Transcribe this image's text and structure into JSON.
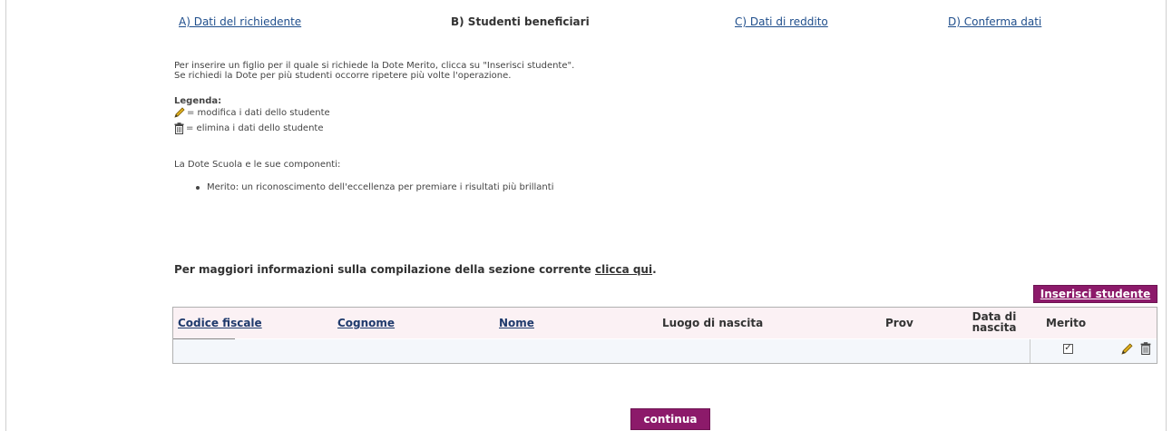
{
  "steps": {
    "a": "A) Dati del richiedente",
    "b": "B) Studenti beneficiari",
    "c": "C) Dati di reddito",
    "d": "D) Conferma dati"
  },
  "intro": {
    "line1": "Per inserire un figlio per il quale si richiede la Dote Merito, clicca su \"Inserisci studente\".",
    "line2": "Se richiedi la Dote per più studenti occorre ripetere più volte l'operazione."
  },
  "legend": {
    "title": "Legenda:",
    "edit": "= modifica i dati dello studente",
    "delete": "= elimina i dati dello studente",
    "edit_icon": "pencil-icon",
    "delete_icon": "trash-icon"
  },
  "components": {
    "label": "La Dote Scuola e le sue componenti:",
    "item1": "Merito: un riconoscimento dell'eccellenza per premiare i risultati più brillanti"
  },
  "moreinfo": {
    "text": "Per maggiori informazioni sulla compilazione della sezione corrente ",
    "link": "clicca qui",
    "suffix": "."
  },
  "buttons": {
    "insert": "Inserisci studente",
    "continue": "continua"
  },
  "table": {
    "headers": {
      "codice": "Codice fiscale",
      "cognome": "Cognome",
      "nome": "Nome",
      "luogo": "Luogo di nascita",
      "prov": "Prov",
      "data_line1": "Data di",
      "data_line2": "nascita",
      "merito": "Merito"
    },
    "row": {
      "merito_checked": true,
      "check_mark": "✓"
    }
  },
  "colors": {
    "accent": "#8c1a6a",
    "header_bg": "#fbf1f4",
    "row_bg": "#f4f7fb",
    "link": "#1f4e8c"
  }
}
